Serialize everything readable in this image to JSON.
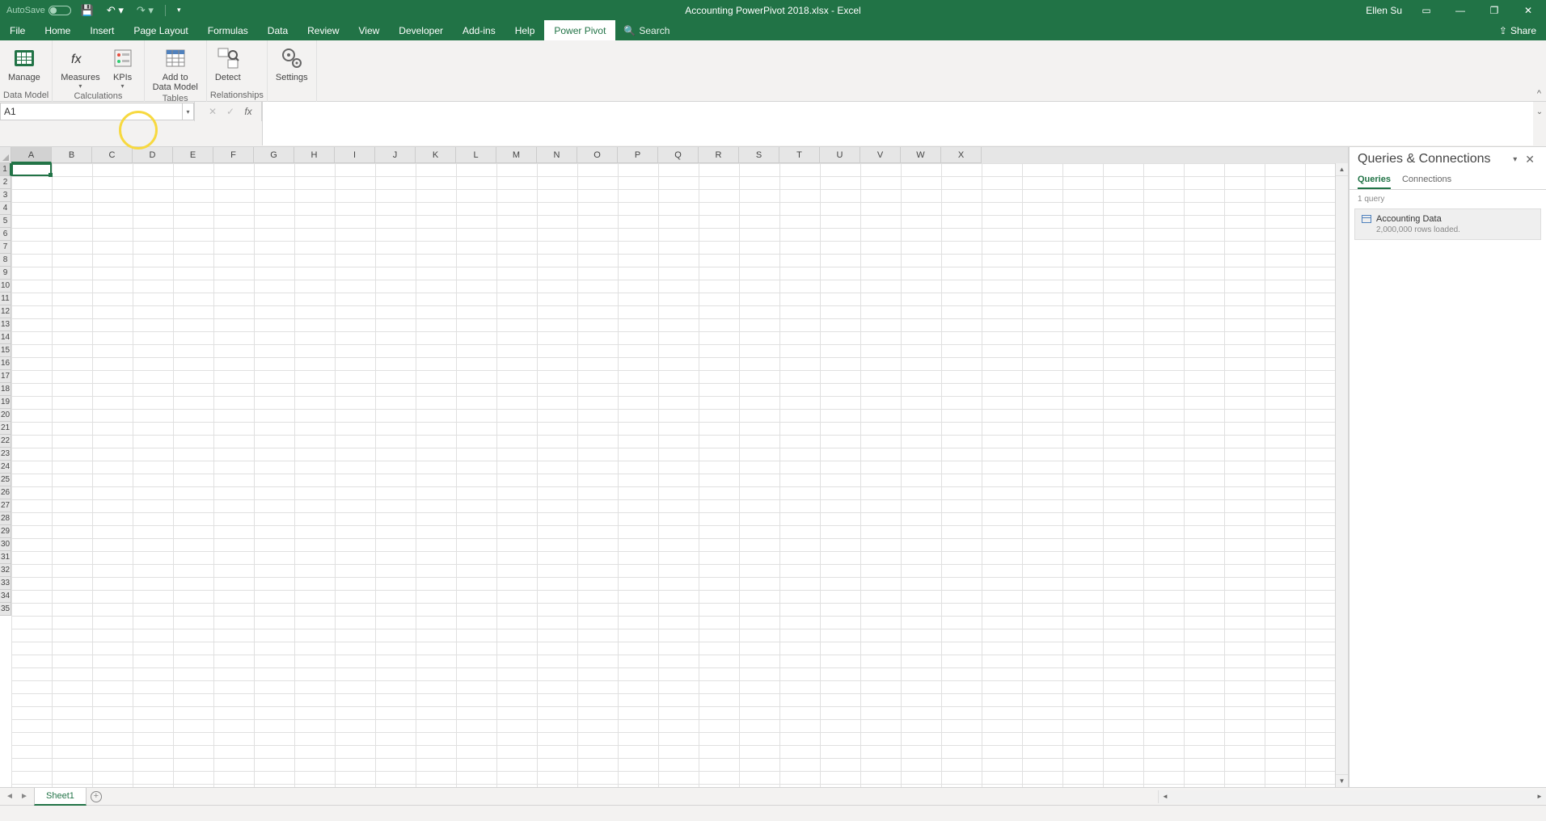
{
  "title": "Accounting PowerPivot 2018.xlsx  -  Excel",
  "autosave_label": "AutoSave",
  "user_name": "Ellen Su",
  "tabs": {
    "file": "File",
    "home": "Home",
    "insert": "Insert",
    "page_layout": "Page Layout",
    "formulas": "Formulas",
    "data": "Data",
    "review": "Review",
    "view": "View",
    "developer": "Developer",
    "addins": "Add-ins",
    "help": "Help",
    "power_pivot": "Power Pivot"
  },
  "tell_me": "Search",
  "share": "Share",
  "ribbon": {
    "manage": "Manage",
    "measures": "Measures",
    "kpis": "KPIs",
    "add_to_dm_1": "Add to",
    "add_to_dm_2": "Data Model",
    "detect": "Detect",
    "settings": "Settings",
    "g_data_model": "Data Model",
    "g_calculations": "Calculations",
    "g_tables": "Tables",
    "g_relationships": "Relationships"
  },
  "name_box": "A1",
  "columns": [
    "A",
    "B",
    "C",
    "D",
    "E",
    "F",
    "G",
    "H",
    "I",
    "J",
    "K",
    "L",
    "M",
    "N",
    "O",
    "P",
    "Q",
    "R",
    "S",
    "T",
    "U",
    "V",
    "W",
    "X"
  ],
  "rows": [
    "1",
    "2",
    "3",
    "4",
    "5",
    "6",
    "7",
    "8",
    "9",
    "10",
    "11",
    "12",
    "13",
    "14",
    "15",
    "16",
    "17",
    "18",
    "19",
    "20",
    "21",
    "22",
    "23",
    "24",
    "25",
    "26",
    "27",
    "28",
    "29",
    "30",
    "31",
    "32",
    "33",
    "34",
    "35"
  ],
  "queries_pane": {
    "title": "Queries & Connections",
    "tab_queries": "Queries",
    "tab_connections": "Connections",
    "count": "1 query",
    "item_name": "Accounting Data",
    "item_sub": "2,000,000 rows loaded."
  },
  "sheet_tab": "Sheet1"
}
